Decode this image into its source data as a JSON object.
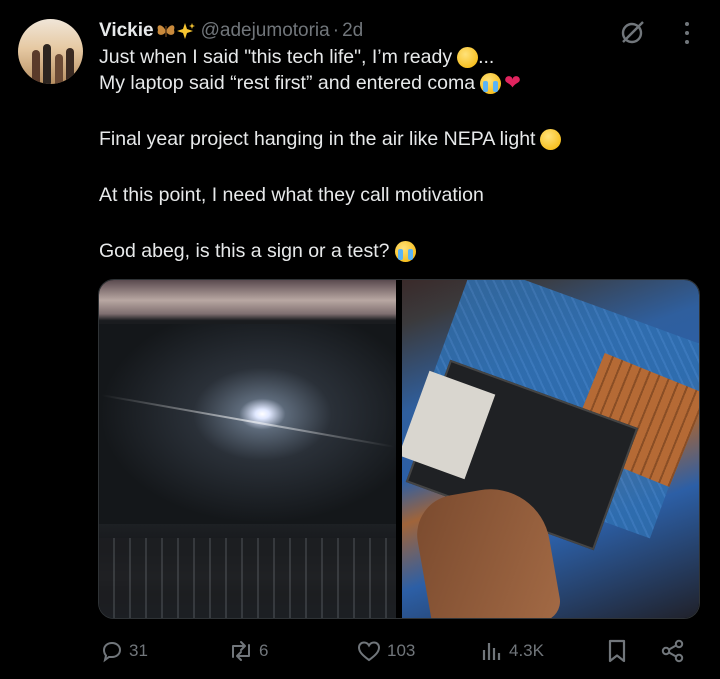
{
  "author": {
    "name": "Vickie",
    "name_emoji": [
      "butterfly-emoji",
      "sparkles-emoji"
    ],
    "handle": "@adejumotoria",
    "separator": "·",
    "time": "2d"
  },
  "tweet": {
    "lines": [
      "Just when I said \"this tech life\", I’m ready",
      "My laptop said “rest first” and entered coma",
      "Final year project hanging in the air like NEPA light",
      "At this point, I need what they call motivation",
      "God abeg, is this a sign or a test?"
    ],
    "line1_suffix": "...",
    "emojis": {
      "line1": "tired-face-emoji",
      "line2": [
        "crying-face-emoji",
        "broken-heart-emoji"
      ],
      "line3": "face-holding-back-tears-emoji",
      "line5": "crying-face-emoji"
    }
  },
  "media": {
    "photos": [
      "laptop-broken-screen-photo",
      "laptop-opened-battery-photo"
    ]
  },
  "actions": {
    "replies": "31",
    "reposts": "6",
    "likes": "103",
    "views": "4.3K"
  },
  "colors": {
    "background": "#000000",
    "text": "#e7e9ea",
    "muted": "#71767b",
    "border": "#2f3336"
  },
  "icons": [
    "grok-icon",
    "more-icon",
    "reply-icon",
    "repost-icon",
    "like-icon",
    "views-icon",
    "bookmark-icon",
    "share-icon"
  ]
}
